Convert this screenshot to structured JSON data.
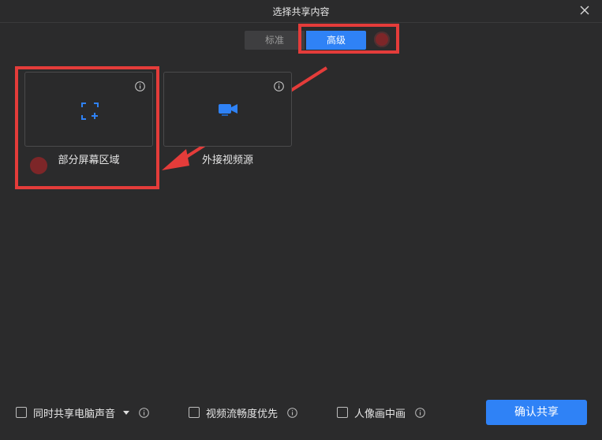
{
  "window": {
    "title": "选择共享内容"
  },
  "tabs": {
    "standard": "标准",
    "advanced": "高级"
  },
  "cards": [
    {
      "label": "部分屏幕区域",
      "icon": "region-select-icon"
    },
    {
      "label": "外接视频源",
      "icon": "camera-icon"
    }
  ],
  "options": {
    "share_audio": "同时共享电脑声音",
    "video_smooth": "视频流畅度优先",
    "pip": "人像画中画"
  },
  "actions": {
    "confirm": "确认共享"
  },
  "colors": {
    "accent": "#2f82f6",
    "highlight": "#e43c3a",
    "background": "#2b2b2c"
  }
}
